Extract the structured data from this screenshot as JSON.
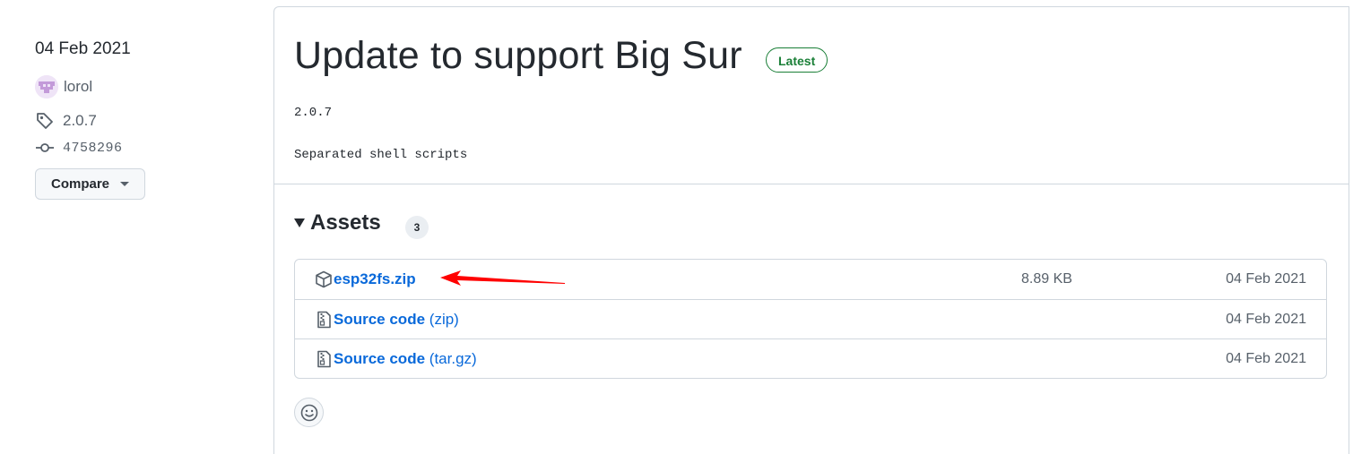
{
  "sidebar": {
    "date": "04 Feb 2021",
    "author": "lorol",
    "tag": "2.0.7",
    "commit": "4758296",
    "compare_label": "Compare"
  },
  "release": {
    "title": "Update to support Big Sur",
    "badge": "Latest",
    "body_version": "2.0.7",
    "body_desc": "Separated shell scripts"
  },
  "assets": {
    "label": "Assets",
    "count": "3",
    "items": [
      {
        "name": "esp32fs.zip",
        "suffix": "",
        "size": "8.89 KB",
        "date": "04 Feb 2021",
        "icon": "package-icon"
      },
      {
        "name": "Source code",
        "suffix": "(zip)",
        "size": "",
        "date": "04 Feb 2021",
        "icon": "file-zip-icon"
      },
      {
        "name": "Source code",
        "suffix": "(tar.gz)",
        "size": "",
        "date": "04 Feb 2021",
        "icon": "file-zip-icon"
      }
    ]
  },
  "colors": {
    "link": "#0969da",
    "badge_green": "#1a7f37",
    "annotation_red": "#ff0000",
    "border": "#d0d7de"
  }
}
